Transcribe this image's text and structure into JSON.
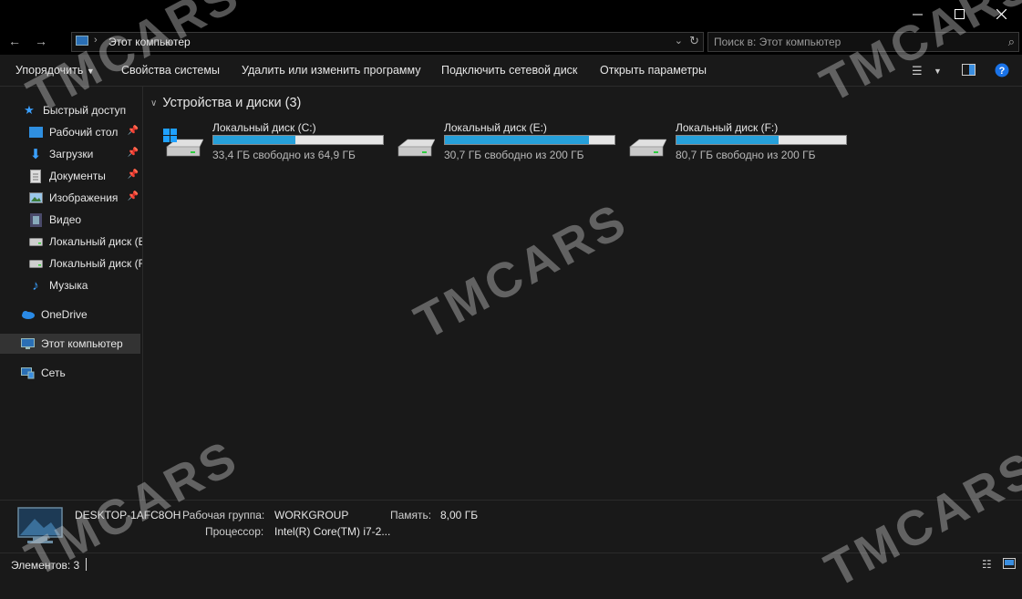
{
  "address": {
    "path": "Этот компьютер"
  },
  "search": {
    "placeholder": "Поиск в: Этот компьютер"
  },
  "ribbon": {
    "organize": "Упорядочить",
    "system_properties": "Свойства системы",
    "uninstall": "Удалить или изменить программу",
    "map_drive": "Подключить сетевой диск",
    "open_settings": "Открыть параметры"
  },
  "sidebar": {
    "quick_access": "Быстрый доступ",
    "items": [
      "Рабочий стол",
      "Загрузки",
      "Документы",
      "Изображения",
      "Видео",
      "Локальный диск (E:)",
      "Локальный диск (F:)",
      "Музыка"
    ],
    "onedrive": "OneDrive",
    "this_pc": "Этот компьютер",
    "network": "Сеть"
  },
  "content": {
    "group_title": "Устройства и диски (3)",
    "drives": [
      {
        "name": "Локальный диск (C:)",
        "free": "33,4 ГБ свободно из 64,9 ГБ",
        "used_fraction": 0.485,
        "system": true
      },
      {
        "name": "Локальный диск (E:)",
        "free": "30,7 ГБ свободно из 200 ГБ",
        "used_fraction": 0.85,
        "system": false
      },
      {
        "name": "Локальный диск (F:)",
        "free": "80,7 ГБ свободно из 200 ГБ",
        "used_fraction": 0.6,
        "system": false
      }
    ]
  },
  "details": {
    "computer_name": "DESKTOP-1AFC8OH",
    "workgroup_label": "Рабочая группа:",
    "workgroup_value": "WORKGROUP",
    "memory_label": "Память:",
    "memory_value": "8,00 ГБ",
    "processor_label": "Процессор:",
    "processor_value": "Intel(R) Core(TM) i7-2..."
  },
  "status": {
    "items_count": "Элементов: 3"
  },
  "watermark": "TMCARS",
  "colors": {
    "accent": "#26a0da",
    "background": "#191919",
    "titlebar": "#000000"
  }
}
